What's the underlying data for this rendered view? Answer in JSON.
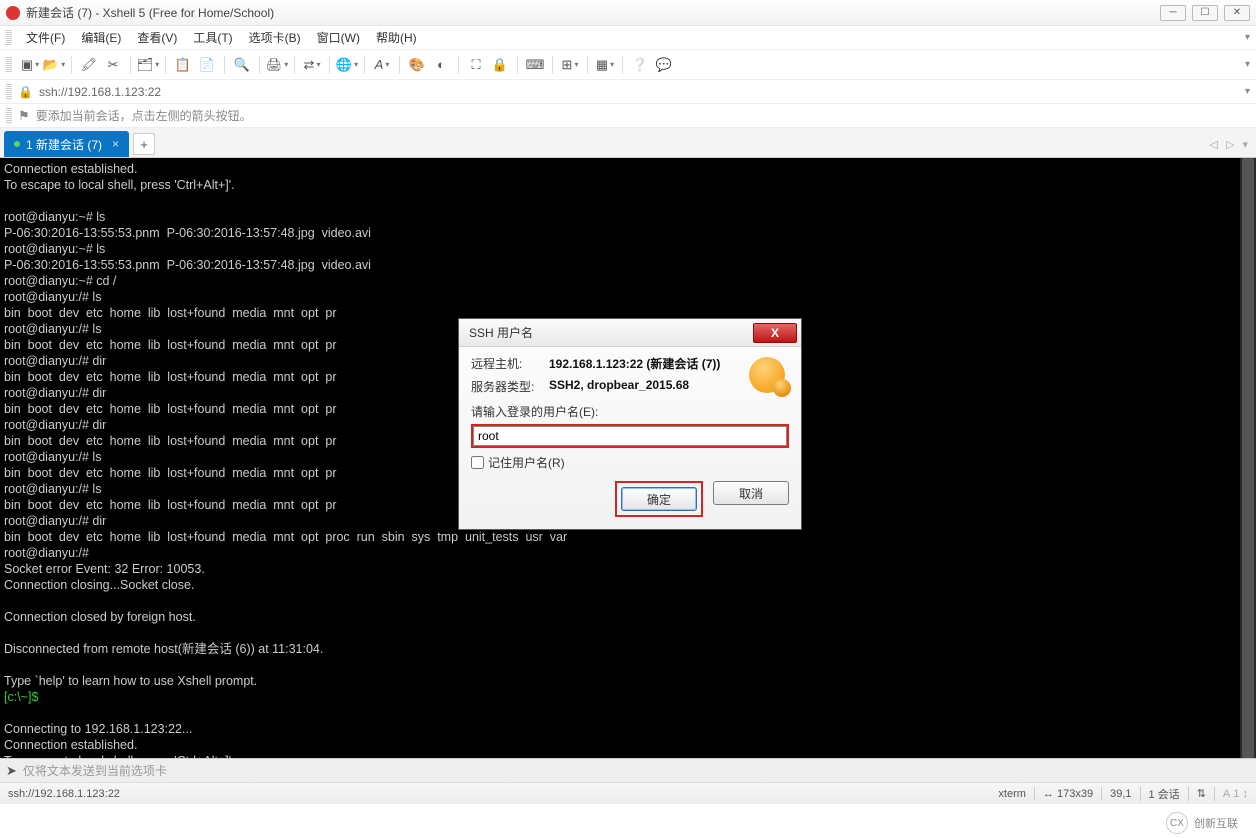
{
  "window": {
    "title": "新建会话 (7) - Xshell 5 (Free for Home/School)"
  },
  "menus": [
    "文件(F)",
    "编辑(E)",
    "查看(V)",
    "工具(T)",
    "选项卡(B)",
    "窗口(W)",
    "帮助(H)"
  ],
  "addressbar": {
    "url": "ssh://192.168.1.123:22"
  },
  "hint": {
    "text": "要添加当前会话，点击左侧的箭头按钮。"
  },
  "tab": {
    "label": "1 新建会话 (7)"
  },
  "terminal": {
    "lines": "Connection established.\nTo escape to local shell, press 'Ctrl+Alt+]'.\n\nroot@dianyu:~# ls\nP-06:30:2016-13:55:53.pnm  P-06:30:2016-13:57:48.jpg  video.avi\nroot@dianyu:~# ls\nP-06:30:2016-13:55:53.pnm  P-06:30:2016-13:57:48.jpg  video.avi\nroot@dianyu:~# cd /\nroot@dianyu:/# ls\nbin  boot  dev  etc  home  lib  lost+found  media  mnt  opt  pr\nroot@dianyu:/# ls\nbin  boot  dev  etc  home  lib  lost+found  media  mnt  opt  pr\nroot@dianyu:/# dir\nbin  boot  dev  etc  home  lib  lost+found  media  mnt  opt  pr\nroot@dianyu:/# dir\nbin  boot  dev  etc  home  lib  lost+found  media  mnt  opt  pr\nroot@dianyu:/# dir\nbin  boot  dev  etc  home  lib  lost+found  media  mnt  opt  pr\nroot@dianyu:/# ls\nbin  boot  dev  etc  home  lib  lost+found  media  mnt  opt  pr\nroot@dianyu:/# ls\nbin  boot  dev  etc  home  lib  lost+found  media  mnt  opt  pr\nroot@dianyu:/# dir\nbin  boot  dev  etc  home  lib  lost+found  media  mnt  opt  proc  run  sbin  sys  tmp  unit_tests  usr  var\nroot@dianyu:/#\nSocket error Event: 32 Error: 10053.\nConnection closing...Socket close.\n\nConnection closed by foreign host.\n\nDisconnected from remote host(新建会话 (6)) at 11:31:04.\n\nType `help' to learn how to use Xshell prompt.",
    "prompt": "[c:\\~]$",
    "tail": "\nConnecting to 192.168.1.123:22...\nConnection established.\nTo escape to local shell, press 'Ctrl+Alt+]'.\n"
  },
  "inputstrip": {
    "placeholder": "仅将文本发送到当前选项卡"
  },
  "statusbar": {
    "conn": "ssh://192.168.1.123:22",
    "term": "xterm",
    "size": "173x39",
    "pos": "39,1",
    "sessions": "1 会话",
    "arrows": "⇅"
  },
  "dialog": {
    "title": "SSH 用户名",
    "host_label": "远程主机:",
    "host_value": "192.168.1.123:22 (新建会话 (7))",
    "server_label": "服务器类型:",
    "server_value": "SSH2, dropbear_2015.68",
    "prompt": "请输入登录的用户名(E):",
    "username": "root",
    "remember": "记住用户名(R)",
    "ok": "确定",
    "cancel": "取消"
  },
  "watermark": "创新互联"
}
